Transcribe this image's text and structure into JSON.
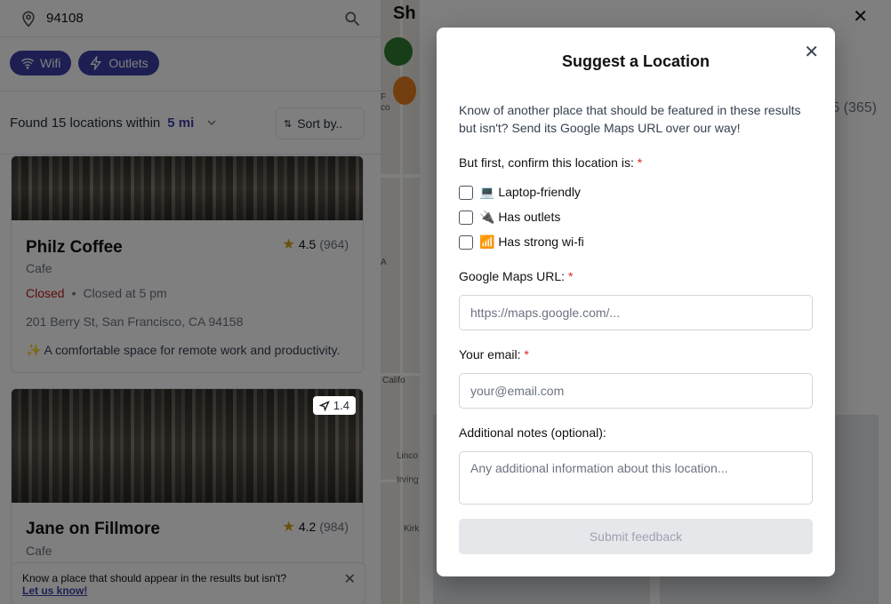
{
  "search": {
    "zip": "94108"
  },
  "filters": [
    {
      "label": "Wifi",
      "icon": "wifi-icon"
    },
    {
      "label": "Outlets",
      "icon": "bolt-icon"
    }
  ],
  "results": {
    "found_text": "Found 15 locations within",
    "radius": "5 mi",
    "sort_label": "Sort by.."
  },
  "cards": [
    {
      "name": "Philz Coffee",
      "type": "Cafe",
      "rating": "4.5",
      "count": "(964)",
      "status": "Closed",
      "status_detail": "Closed at 5 pm",
      "address": "201 Berry St, San Francisco, CA 94158",
      "description": "✨ A comfortable space for remote work and productivity."
    },
    {
      "name": "Jane on Fillmore",
      "type": "Cafe",
      "rating": "4.2",
      "count": "(984)",
      "distance": "1.4"
    }
  ],
  "toast": {
    "text": "Know a place that should appear in the results but isn't?",
    "link": "Let us know!"
  },
  "map": {
    "labels": [
      "F",
      "co",
      "A",
      "Califo",
      "Linco",
      "Irving",
      "Kirk"
    ]
  },
  "detail": {
    "title": "Sh",
    "rating_count": "5 (365)"
  },
  "modal": {
    "title": "Suggest a Location",
    "intro": "Know of another place that should be featured in these results but isn't? Send its Google Maps URL over our way!",
    "confirm_label": "But first, confirm this location is:",
    "required_mark": "*",
    "checkboxes": [
      {
        "label": "💻 Laptop-friendly",
        "checked": false
      },
      {
        "label": "🔌 Has outlets",
        "checked": false
      },
      {
        "label": "📶 Has strong wi-fi",
        "checked": false
      }
    ],
    "url_label": "Google Maps URL:",
    "url_placeholder": "https://maps.google.com/...",
    "email_label": "Your email:",
    "email_placeholder": "your@email.com",
    "notes_label": "Additional notes (optional):",
    "notes_placeholder": "Any additional information about this location...",
    "submit_label": "Submit feedback"
  },
  "colors": {
    "accent": "#3b3fa6",
    "required": "#dc2626",
    "closed": "#b91c1c"
  }
}
